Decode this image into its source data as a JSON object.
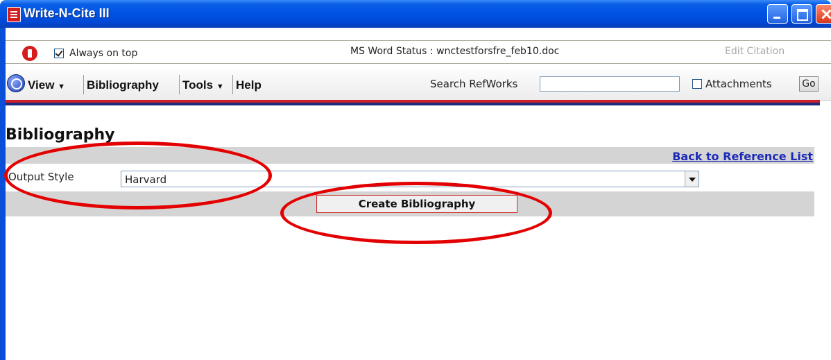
{
  "window": {
    "title": "Write-N-Cite III"
  },
  "status_bar": {
    "always_on_top_label": "Always on top",
    "always_on_top_checked": true,
    "ms_word_status": "MS Word Status : wnctestforsfre_feb10.doc",
    "edit_citation": "Edit Citation"
  },
  "toolbar": {
    "menus": {
      "view": "View",
      "bibliography": "Bibliography",
      "tools": "Tools",
      "help": "Help"
    },
    "search_label": "Search RefWorks",
    "search_value": "",
    "attachments_label": "Attachments",
    "attachments_checked": false,
    "go_label": "Go"
  },
  "main": {
    "heading": "Bibliography",
    "back_link": "Back to Reference List",
    "output_style_label": "Output Style",
    "output_style_value": "Harvard",
    "create_button": "Create Bibliography"
  },
  "colors": {
    "annotation": "#e30000",
    "link": "#1d2ab8",
    "accent_red": "#cc1f2a",
    "accent_navy": "#1a2a7e"
  }
}
